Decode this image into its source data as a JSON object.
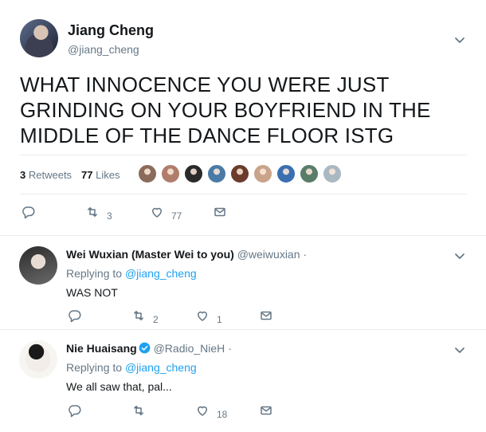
{
  "main_tweet": {
    "author_name": "Jiang Cheng",
    "author_handle": "@jiang_cheng",
    "text": "WHAT INNOCENCE YOU WERE JUST GRINDING ON YOUR BOYFRIEND IN THE MIDDLE OF THE DANCE FLOOR ISTG",
    "retweets_count": "3",
    "retweets_label": "Retweets",
    "likes_count": "77",
    "likes_label": "Likes",
    "likers": [
      "#8a6b5a",
      "#b07d6b",
      "#2a2a2a",
      "#4a7ba6",
      "#6b3b2b",
      "#c9a38a",
      "#3b6fb0",
      "#5a7d6a",
      "#aab8c2"
    ],
    "actions": {
      "reply_count": "",
      "retweet_count": "3",
      "like_count": "77"
    }
  },
  "replies": [
    {
      "author_name": "Wei Wuxian (Master Wei to you)",
      "author_handle": "@weiwuxian",
      "separator": "·",
      "verified": false,
      "replying_prefix": "Replying to",
      "replying_to": "@jiang_cheng",
      "text": "WAS NOT",
      "actions": {
        "reply_count": "",
        "retweet_count": "2",
        "like_count": "1"
      }
    },
    {
      "author_name": "Nie Huaisang",
      "author_handle": "@Radio_NieH",
      "separator": "·",
      "verified": true,
      "replying_prefix": "Replying to",
      "replying_to": "@jiang_cheng",
      "text": "We all saw that, pal...",
      "actions": {
        "reply_count": "",
        "retweet_count": "",
        "like_count": "18"
      }
    }
  ],
  "colors": {
    "accent": "#1da1f2",
    "muted": "#657786",
    "text": "#14171a",
    "border": "#e6ecf0"
  }
}
